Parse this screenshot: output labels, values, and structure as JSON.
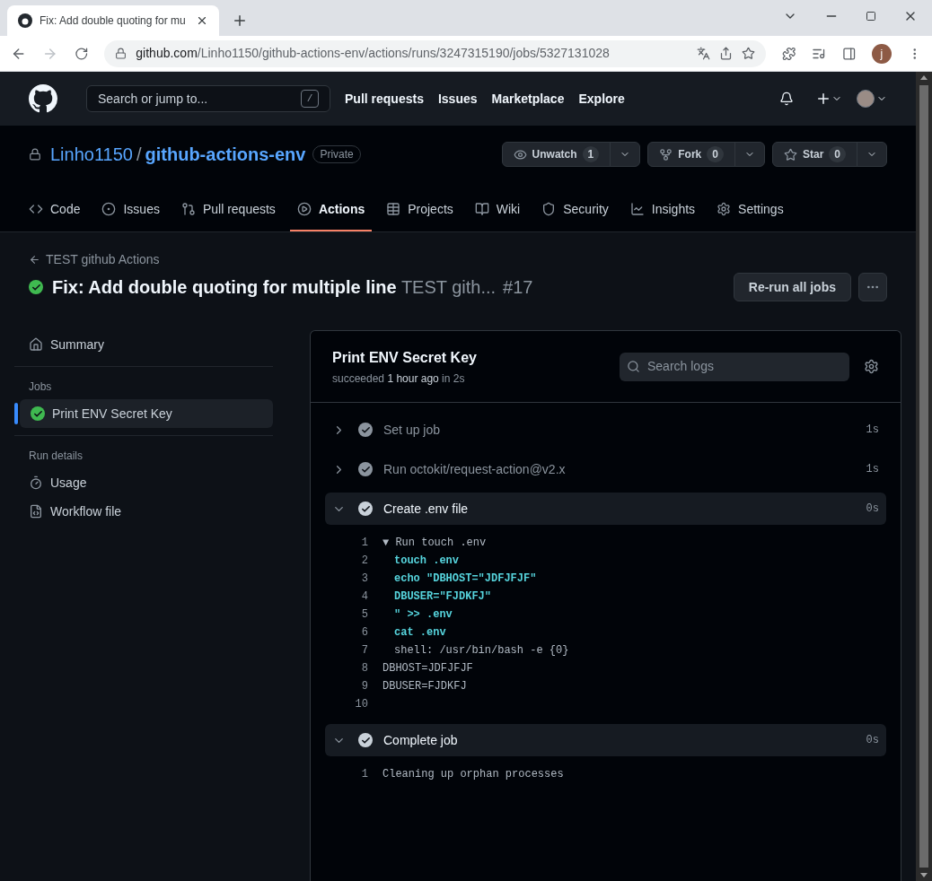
{
  "browser": {
    "tab_title": "Fix: Add double quoting for mu",
    "url_host": "github.com",
    "url_path": "/Linho1150/github-actions-env/actions/runs/3247315190/jobs/5327131028",
    "profile_initial": "j"
  },
  "header": {
    "search_placeholder": "Search or jump to...",
    "search_key": "/",
    "nav": [
      "Pull requests",
      "Issues",
      "Marketplace",
      "Explore"
    ]
  },
  "repo": {
    "owner": "Linho1150",
    "separator": "/",
    "name": "github-actions-env",
    "visibility": "Private",
    "actions": [
      {
        "kind": "watch",
        "label": "Unwatch",
        "count": "1"
      },
      {
        "kind": "fork",
        "label": "Fork",
        "count": "0"
      },
      {
        "kind": "star",
        "label": "Star",
        "count": "0"
      }
    ]
  },
  "tabs": [
    {
      "kind": "code",
      "label": "Code",
      "selected": false
    },
    {
      "kind": "issues",
      "label": "Issues",
      "selected": false
    },
    {
      "kind": "pulls",
      "label": "Pull requests",
      "selected": false
    },
    {
      "kind": "actions",
      "label": "Actions",
      "selected": true
    },
    {
      "kind": "projects",
      "label": "Projects",
      "selected": false
    },
    {
      "kind": "wiki",
      "label": "Wiki",
      "selected": false
    },
    {
      "kind": "security",
      "label": "Security",
      "selected": false
    },
    {
      "kind": "insights",
      "label": "Insights",
      "selected": false
    },
    {
      "kind": "settings",
      "label": "Settings",
      "selected": false
    }
  ],
  "run": {
    "back_link": "TEST github Actions",
    "title": "Fix: Add double quoting for multiple line",
    "workflow": "TEST gith...",
    "number": "#17",
    "rerun_button": "Re-run all jobs"
  },
  "sidebar": {
    "summary": "Summary",
    "jobs_heading": "Jobs",
    "jobs": [
      {
        "name": "Print ENV Secret Key",
        "selected": true
      }
    ],
    "details_heading": "Run details",
    "details": [
      {
        "kind": "usage",
        "label": "Usage"
      },
      {
        "kind": "workflow",
        "label": "Workflow file"
      }
    ]
  },
  "job": {
    "title": "Print ENV Secret Key",
    "status": "succeeded ",
    "time": "1 hour ago",
    "duration_text": " in 2s",
    "search_placeholder": "Search logs",
    "steps": [
      {
        "name": "Set up job",
        "duration": "1s",
        "expanded": false
      },
      {
        "name": "Run octokit/request-action@v2.x",
        "duration": "1s",
        "expanded": false
      },
      {
        "name": "Create .env file",
        "duration": "0s",
        "expanded": true,
        "lines": [
          {
            "number": "1",
            "kind": "group",
            "text": "▼ Run touch .env"
          },
          {
            "number": "2",
            "kind": "command",
            "text": "touch .env"
          },
          {
            "number": "3",
            "kind": "command",
            "text": "echo \"DBHOST=\"JDFJFJF\""
          },
          {
            "number": "4",
            "kind": "command",
            "text": "DBUSER=\"FJDKFJ\""
          },
          {
            "number": "5",
            "kind": "command",
            "text": "\" >> .env"
          },
          {
            "number": "6",
            "kind": "command",
            "text": "cat .env"
          },
          {
            "number": "7",
            "kind": "shell",
            "text": "shell: /usr/bin/bash -e {0}"
          },
          {
            "number": "8",
            "kind": "output",
            "text": "DBHOST=JDFJFJF"
          },
          {
            "number": "9",
            "kind": "output",
            "text": "DBUSER=FJDKFJ"
          },
          {
            "number": "10"
          }
        ]
      },
      {
        "name": "Complete job",
        "duration": "0s",
        "expanded": true,
        "lines": [
          {
            "number": "1",
            "kind": "output",
            "text": "Cleaning up orphan processes"
          }
        ]
      }
    ]
  }
}
